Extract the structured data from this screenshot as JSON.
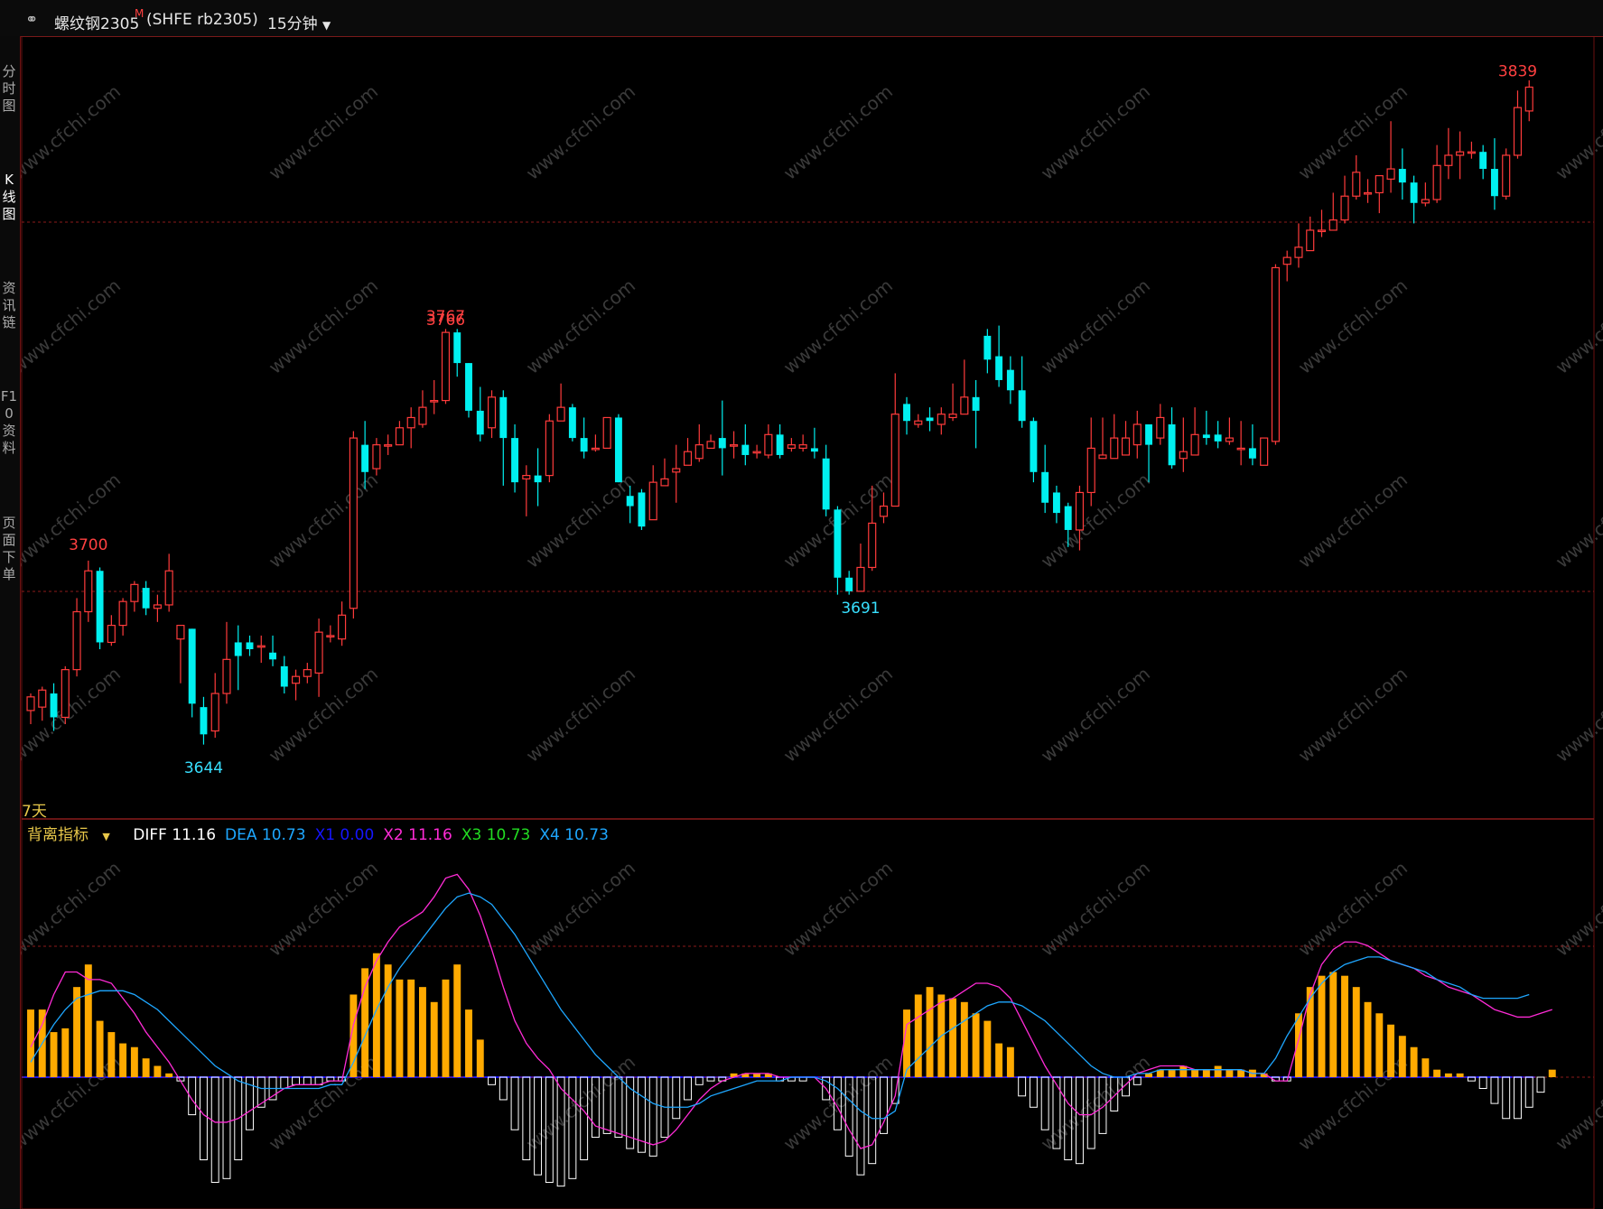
{
  "header": {
    "instrument": "螺纹钢2305",
    "sup": "M",
    "code": "(SHFE rb2305)",
    "period": "15分钟",
    "link_icon": "link-icon",
    "dropdown_icon": "chevron-down-icon"
  },
  "side_tabs": [
    "分时图",
    "K线图",
    "资讯链",
    "F10资料",
    "页面下单"
  ],
  "range_label": "7天",
  "indicator": {
    "name": "背离指标",
    "items": [
      {
        "label": "DIFF",
        "value": "11.16",
        "color": "#ffffff"
      },
      {
        "label": "DEA",
        "value": "10.73",
        "color": "#1ea7ff"
      },
      {
        "label": "X1",
        "value": "0.00",
        "color": "#1515ff"
      },
      {
        "label": "X2",
        "value": "11.16",
        "color": "#ff2bd6"
      },
      {
        "label": "X3",
        "value": "10.73",
        "color": "#22dd22"
      },
      {
        "label": "X4",
        "value": "10.73",
        "color": "#1ea7ff"
      }
    ]
  },
  "price_marks": [
    {
      "text": "3700",
      "kind": "high"
    },
    {
      "text": "3644",
      "kind": "low"
    },
    {
      "text": "3767",
      "kind": "high"
    },
    {
      "text": "3691",
      "kind": "low"
    },
    {
      "text": "3766",
      "kind": "high"
    },
    {
      "text": "3839",
      "kind": "high"
    }
  ],
  "watermark": "www.cfchi.com",
  "colors": {
    "up": "#ff3b3b",
    "down": "#00f0f0",
    "hist_pos": "#ffaa00",
    "hist_neg": "#ffffff",
    "grid": "#8b1a1a",
    "label_high": "#ff4040",
    "label_low": "#38e0ff",
    "header_text": "#e6e6e6"
  },
  "chart_data": {
    "type": "candlestick",
    "timeframe": "15分钟",
    "x_axis": "bar index",
    "y_axis": "price",
    "ylim": [
      3630,
      3850
    ],
    "candles": [
      [
        3656,
        3660,
        3652,
        3661
      ],
      [
        3657,
        3662,
        3653,
        3663
      ],
      [
        3661,
        3654,
        3650,
        3664
      ],
      [
        3654,
        3668,
        3652,
        3669
      ],
      [
        3668,
        3685,
        3666,
        3689
      ],
      [
        3685,
        3697,
        3682,
        3700
      ],
      [
        3697,
        3676,
        3674,
        3698
      ],
      [
        3676,
        3681,
        3675,
        3684
      ],
      [
        3681,
        3688,
        3678,
        3689
      ],
      [
        3688,
        3693,
        3685,
        3694
      ],
      [
        3692,
        3686,
        3684,
        3694
      ],
      [
        3686,
        3687,
        3682,
        3690
      ],
      [
        3687,
        3697,
        3685,
        3702
      ],
      [
        3677,
        3681,
        3664,
        3681
      ],
      [
        3680,
        3658,
        3654,
        3680
      ],
      [
        3657,
        3649,
        3646,
        3660
      ],
      [
        3650,
        3661,
        3648,
        3667
      ],
      [
        3661,
        3671,
        3658,
        3682
      ],
      [
        3676,
        3672,
        3662,
        3681
      ],
      [
        3676,
        3674,
        3672,
        3678
      ],
      [
        3675,
        3675,
        3670,
        3678
      ],
      [
        3673,
        3671,
        3669,
        3678
      ],
      [
        3669,
        3663,
        3661,
        3672
      ],
      [
        3664,
        3666,
        3659,
        3668
      ],
      [
        3666,
        3668,
        3664,
        3670
      ],
      [
        3667,
        3679,
        3660,
        3683
      ],
      [
        3678,
        3678,
        3676,
        3681
      ],
      [
        3677,
        3684,
        3675,
        3688
      ],
      [
        3686,
        3736,
        3683,
        3738
      ],
      [
        3734,
        3726,
        3721,
        3741
      ],
      [
        3727,
        3734,
        3725,
        3736
      ],
      [
        3734,
        3734,
        3731,
        3737
      ],
      [
        3734,
        3739,
        3734,
        3741
      ],
      [
        3739,
        3742,
        3733,
        3745
      ],
      [
        3740,
        3745,
        3739,
        3750
      ],
      [
        3747,
        3747,
        3743,
        3753
      ],
      [
        3747,
        3767,
        3746,
        3768
      ],
      [
        3767,
        3758,
        3754,
        3768
      ],
      [
        3758,
        3744,
        3742,
        3758
      ],
      [
        3744,
        3737,
        3735,
        3751
      ],
      [
        3739,
        3748,
        3736,
        3750
      ],
      [
        3748,
        3736,
        3722,
        3750
      ],
      [
        3736,
        3723,
        3720,
        3740
      ],
      [
        3724,
        3725,
        3713,
        3728
      ],
      [
        3725,
        3723,
        3716,
        3733
      ],
      [
        3725,
        3741,
        3723,
        3743
      ],
      [
        3741,
        3745,
        3741,
        3752
      ],
      [
        3745,
        3736,
        3735,
        3746
      ],
      [
        3736,
        3732,
        3730,
        3742
      ],
      [
        3733,
        3733,
        3732,
        3737
      ],
      [
        3733,
        3742,
        3733,
        3742
      ],
      [
        3742,
        3723,
        3723,
        3743
      ],
      [
        3719,
        3716,
        3711,
        3722
      ],
      [
        3720,
        3710,
        3709,
        3721
      ],
      [
        3712,
        3723,
        3712,
        3728
      ],
      [
        3722,
        3724,
        3722,
        3730
      ],
      [
        3726,
        3727,
        3717,
        3734
      ],
      [
        3728,
        3732,
        3728,
        3736
      ],
      [
        3730,
        3734,
        3729,
        3740
      ],
      [
        3733,
        3735,
        3733,
        3737
      ],
      [
        3736,
        3733,
        3725,
        3747
      ],
      [
        3734,
        3734,
        3730,
        3738
      ],
      [
        3734,
        3731,
        3728,
        3740
      ],
      [
        3732,
        3732,
        3730,
        3734
      ],
      [
        3731,
        3737,
        3730,
        3740
      ],
      [
        3737,
        3731,
        3730,
        3740
      ],
      [
        3733,
        3734,
        3732,
        3736
      ],
      [
        3733,
        3734,
        3732,
        3737
      ],
      [
        3733,
        3732,
        3730,
        3739
      ],
      [
        3730,
        3715,
        3713,
        3734
      ],
      [
        3715,
        3695,
        3690,
        3716
      ],
      [
        3695,
        3691,
        3690,
        3697
      ],
      [
        3691,
        3698,
        3691,
        3705
      ],
      [
        3698,
        3711,
        3697,
        3722
      ],
      [
        3713,
        3716,
        3711,
        3720
      ],
      [
        3716,
        3743,
        3728,
        3755
      ],
      [
        3746,
        3741,
        3737,
        3748
      ],
      [
        3740,
        3741,
        3739,
        3743
      ],
      [
        3742,
        3741,
        3738,
        3745
      ],
      [
        3740,
        3743,
        3737,
        3745
      ],
      [
        3742,
        3743,
        3741,
        3752
      ],
      [
        3743,
        3748,
        3743,
        3759
      ],
      [
        3748,
        3744,
        3733,
        3753
      ],
      [
        3766,
        3759,
        3755,
        3768
      ],
      [
        3760,
        3753,
        3751,
        3769
      ],
      [
        3756,
        3750,
        3746,
        3760
      ],
      [
        3750,
        3741,
        3739,
        3760
      ],
      [
        3741,
        3726,
        3723,
        3742
      ],
      [
        3726,
        3717,
        3714,
        3734
      ],
      [
        3720,
        3714,
        3711,
        3722
      ],
      [
        3716,
        3709,
        3704,
        3717
      ],
      [
        3709,
        3720,
        3703,
        3722
      ],
      [
        3720,
        3733,
        3716,
        3742
      ],
      [
        3730,
        3731,
        3730,
        3742
      ],
      [
        3730,
        3736,
        3730,
        3743
      ],
      [
        3731,
        3736,
        3731,
        3741
      ],
      [
        3734,
        3740,
        3730,
        3744
      ],
      [
        3740,
        3734,
        3723,
        3740
      ],
      [
        3736,
        3742,
        3734,
        3746
      ],
      [
        3740,
        3728,
        3727,
        3745
      ],
      [
        3730,
        3732,
        3726,
        3742
      ],
      [
        3731,
        3737,
        3731,
        3745
      ],
      [
        3737,
        3736,
        3734,
        3744
      ],
      [
        3737,
        3735,
        3733,
        3741
      ],
      [
        3735,
        3736,
        3734,
        3742
      ],
      [
        3733,
        3733,
        3728,
        3741
      ],
      [
        3733,
        3730,
        3728,
        3740
      ],
      [
        3728,
        3736,
        3730,
        3736
      ],
      [
        3735,
        3786,
        3734,
        3787
      ],
      [
        3787,
        3789,
        3782,
        3791
      ],
      [
        3789,
        3792,
        3786,
        3799
      ],
      [
        3791,
        3797,
        3791,
        3801
      ],
      [
        3797,
        3797,
        3795,
        3803
      ],
      [
        3797,
        3800,
        3798,
        3808
      ],
      [
        3800,
        3807,
        3799,
        3813
      ],
      [
        3807,
        3814,
        3806,
        3819
      ],
      [
        3808,
        3808,
        3805,
        3812
      ],
      [
        3808,
        3813,
        3802,
        3812
      ],
      [
        3812,
        3815,
        3808,
        3829
      ],
      [
        3815,
        3811,
        3806,
        3821
      ],
      [
        3811,
        3805,
        3799,
        3813
      ],
      [
        3805,
        3806,
        3804,
        3811
      ],
      [
        3806,
        3816,
        3805,
        3822
      ],
      [
        3816,
        3819,
        3812,
        3827
      ],
      [
        3819,
        3820,
        3812,
        3826
      ],
      [
        3820,
        3820,
        3818,
        3823
      ],
      [
        3820,
        3815,
        3812,
        3822
      ],
      [
        3815,
        3807,
        3803,
        3824
      ],
      [
        3807,
        3819,
        3806,
        3821
      ],
      [
        3819,
        3833,
        3818,
        3838
      ],
      [
        3832,
        3839,
        3829,
        3841
      ]
    ],
    "marks": [
      {
        "label": "3700",
        "value": 3700
      },
      {
        "label": "3644",
        "value": 3644
      },
      {
        "label": "3767",
        "value": 3767
      },
      {
        "label": "3691",
        "value": 3691
      },
      {
        "label": "3766",
        "value": 3766
      },
      {
        "label": "3839",
        "value": 3839
      }
    ],
    "indicator_chart": {
      "type": "histogram+lines",
      "histogram": [
        18,
        18,
        12,
        13,
        24,
        30,
        15,
        12,
        9,
        8,
        5,
        3,
        1,
        -1,
        -10,
        -22,
        -28,
        -27,
        -22,
        -14,
        -8,
        -6,
        -3,
        -2,
        -2,
        -2,
        -1,
        -1,
        22,
        29,
        33,
        30,
        26,
        26,
        24,
        20,
        26,
        30,
        18,
        10,
        -2,
        -6,
        -14,
        -22,
        -26,
        -28,
        -29,
        -27,
        -22,
        -16,
        -15,
        -16,
        -19,
        -20,
        -21,
        -16,
        -11,
        -6,
        -2,
        -1,
        -1,
        1,
        1,
        1,
        1,
        -1,
        -1,
        -1,
        0,
        -6,
        -14,
        -21,
        -26,
        -23,
        -15,
        -7,
        18,
        22,
        24,
        22,
        21,
        20,
        17,
        15,
        9,
        8,
        -5,
        -8,
        -14,
        -19,
        -22,
        -23,
        -19,
        -15,
        -9,
        -5,
        -2,
        1,
        2,
        2,
        3,
        2,
        2,
        3,
        2,
        2,
        2,
        1,
        -1,
        -1,
        17,
        24,
        27,
        28,
        27,
        24,
        20,
        17,
        14,
        11,
        8,
        5,
        2,
        1,
        1,
        -1,
        -3,
        -7,
        -11,
        -11,
        -8,
        -4,
        2
      ],
      "lines": {
        "DIFF_X2": [
          8,
          14,
          22,
          28,
          28,
          26,
          26,
          25,
          21,
          17,
          12,
          8,
          4,
          -1,
          -6,
          -10,
          -12,
          -12,
          -11,
          -9,
          -7,
          -5,
          -3,
          -2,
          -2,
          -2,
          -1,
          -1,
          14,
          24,
          31,
          36,
          40,
          42,
          44,
          48,
          53,
          54,
          50,
          43,
          34,
          24,
          15,
          9,
          5,
          2,
          -3,
          -6,
          -9,
          -13,
          -14,
          -15,
          -16,
          -17,
          -18,
          -17,
          -14,
          -10,
          -6,
          -3,
          -1,
          0,
          1,
          1,
          1,
          0,
          0,
          0,
          0,
          -3,
          -8,
          -14,
          -19,
          -18,
          -12,
          -5,
          14,
          16,
          18,
          20,
          21,
          23,
          25,
          25,
          24,
          21,
          15,
          9,
          3,
          -2,
          -7,
          -10,
          -10,
          -8,
          -5,
          -2,
          1,
          2,
          3,
          3,
          3,
          2,
          2,
          2,
          2,
          2,
          1,
          1,
          -1,
          -1,
          10,
          22,
          30,
          34,
          36,
          36,
          35,
          33,
          31,
          30,
          29,
          27,
          26,
          24,
          23,
          22,
          20,
          18,
          17,
          16,
          16,
          17,
          18
        ],
        "DEA_X4": [
          4,
          9,
          14,
          18,
          21,
          22,
          23,
          23,
          23,
          22,
          20,
          18,
          15,
          12,
          9,
          6,
          3,
          1,
          -1,
          -2,
          -3,
          -3,
          -3,
          -3,
          -3,
          -3,
          -2,
          -2,
          4,
          11,
          18,
          24,
          29,
          33,
          37,
          41,
          45,
          48,
          49,
          48,
          46,
          42,
          38,
          33,
          28,
          23,
          18,
          14,
          10,
          6,
          3,
          0,
          -3,
          -5,
          -7,
          -8,
          -8,
          -8,
          -7,
          -5,
          -4,
          -3,
          -2,
          -1,
          -1,
          -1,
          0,
          0,
          0,
          -1,
          -3,
          -6,
          -9,
          -11,
          -11,
          -9,
          2,
          5,
          8,
          11,
          13,
          15,
          17,
          19,
          20,
          20,
          19,
          17,
          15,
          12,
          9,
          6,
          3,
          1,
          0,
          0,
          1,
          1,
          2,
          2,
          2,
          2,
          2,
          2,
          2,
          2,
          1,
          1,
          5,
          11,
          16,
          21,
          25,
          28,
          30,
          31,
          32,
          32,
          31,
          30,
          29,
          28,
          26,
          25,
          24,
          22,
          21,
          21,
          21,
          21,
          22
        ]
      },
      "zero_line": true
    }
  }
}
